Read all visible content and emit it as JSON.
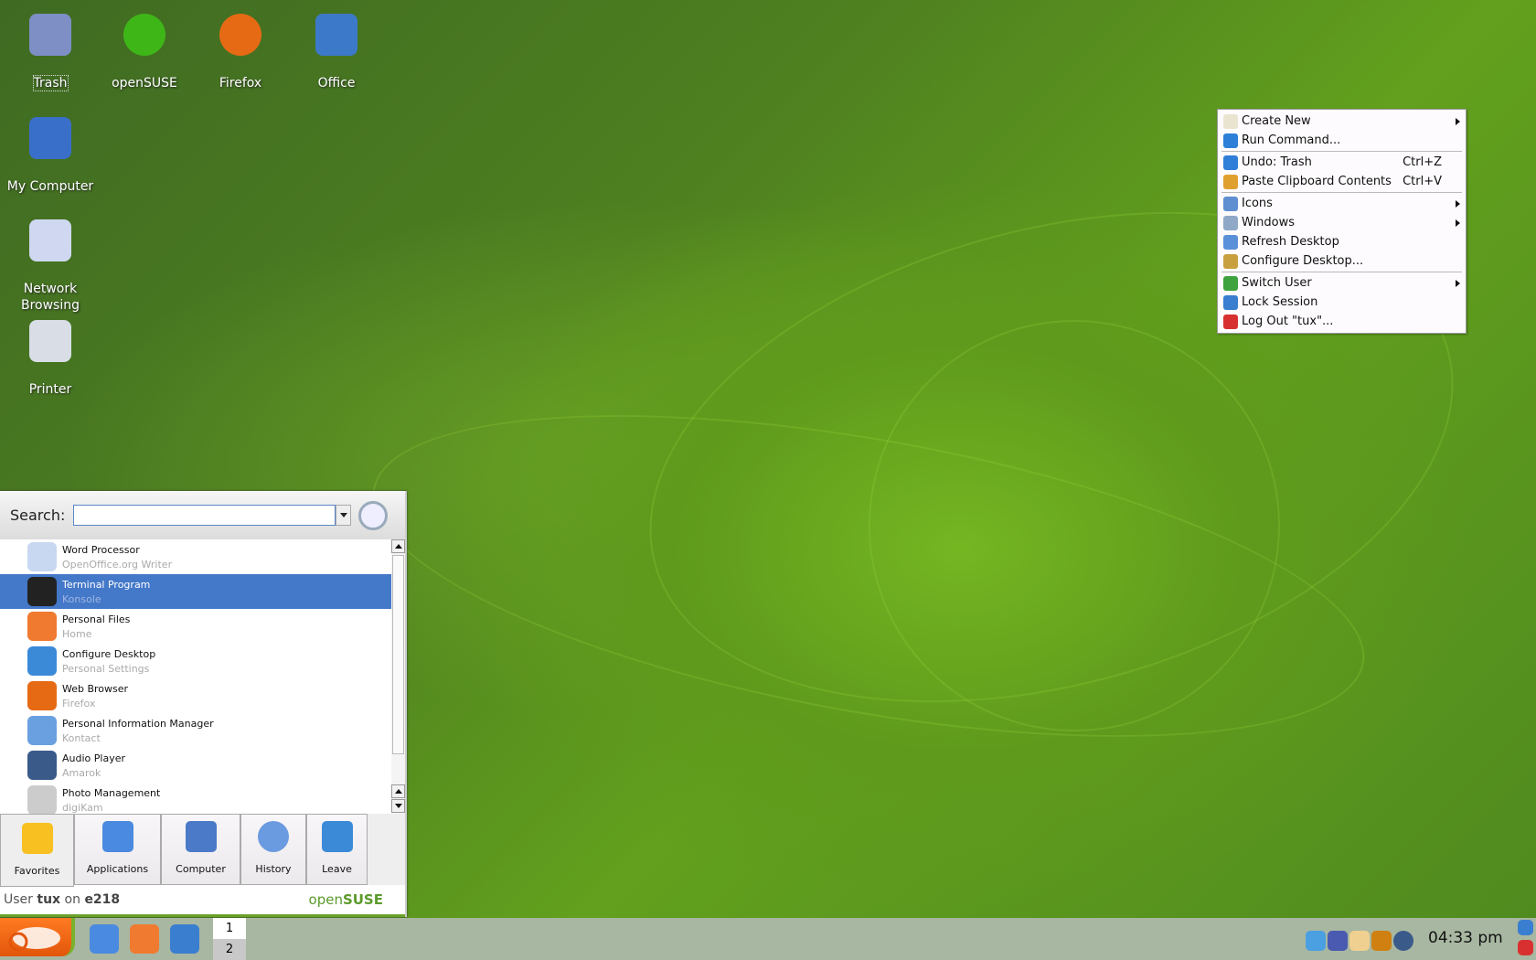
{
  "desktop_icons": [
    {
      "label": "Trash",
      "icon": "trash-icon",
      "color": "#7d8fc5"
    },
    {
      "label": "openSUSE",
      "icon": "opensuse-icon",
      "color": "#3fb618"
    },
    {
      "label": "Firefox",
      "icon": "firefox-icon",
      "color": "#e66a14"
    },
    {
      "label": "Office",
      "icon": "office-icon",
      "color": "#3d79c9"
    },
    {
      "label": "My Computer",
      "icon": "computer-icon",
      "color": "#3a6fc9"
    },
    {
      "label": "Network Browsing",
      "icon": "network-icon",
      "color": "#cfd8f0"
    },
    {
      "label": "Printer",
      "icon": "printer-icon",
      "color": "#d8dde6"
    }
  ],
  "context_menu": {
    "items": [
      {
        "label": "Create New",
        "icon": "new-file-icon",
        "color": "#e8e4d0",
        "submenu": true
      },
      {
        "label": "Run Command...",
        "icon": "run-icon",
        "color": "#2d7fd8"
      },
      {
        "label": "Undo: Trash",
        "shortcut": "Ctrl+Z",
        "icon": "undo-icon",
        "color": "#2f7fd8"
      },
      {
        "label": "Paste Clipboard Contents",
        "shortcut": "Ctrl+V",
        "icon": "paste-icon",
        "color": "#e0a030"
      },
      {
        "label": "Icons",
        "icon": "icons-icon",
        "color": "#5f8fd0",
        "submenu": true
      },
      {
        "label": "Windows",
        "icon": "windows-icon",
        "color": "#8fa8c8",
        "submenu": true
      },
      {
        "label": "Refresh Desktop",
        "icon": "refresh-icon",
        "color": "#5a90d8"
      },
      {
        "label": "Configure Desktop...",
        "icon": "wrench-icon",
        "color": "#c8a040"
      },
      {
        "label": "Switch User",
        "icon": "switch-user-icon",
        "color": "#3ea23e",
        "submenu": true
      },
      {
        "label": "Lock Session",
        "icon": "lock-icon",
        "color": "#3a7ed0"
      },
      {
        "label": "Log Out \"tux\"...",
        "icon": "logout-icon",
        "color": "#d83030"
      }
    ]
  },
  "launcher": {
    "search_label": "Search:",
    "search_value": "",
    "items": [
      {
        "title": "Word Processor",
        "subtitle": "OpenOffice.org Writer",
        "icon": "writer-icon",
        "color": "#c8d8f0"
      },
      {
        "title": "Terminal Program",
        "subtitle": "Konsole",
        "icon": "terminal-icon",
        "color": "#222"
      },
      {
        "title": "Personal Files",
        "subtitle": "Home",
        "icon": "home-icon",
        "color": "#f07a30"
      },
      {
        "title": "Configure Desktop",
        "subtitle": "Personal Settings",
        "icon": "configure-desktop-icon",
        "color": "#3a8ad8"
      },
      {
        "title": "Web Browser",
        "subtitle": "Firefox",
        "icon": "firefox-icon",
        "color": "#e66a14"
      },
      {
        "title": "Personal Information Manager",
        "subtitle": "Kontact",
        "icon": "kontact-icon",
        "color": "#6aa0e0"
      },
      {
        "title": "Audio Player",
        "subtitle": "Amarok",
        "icon": "amarok-icon",
        "color": "#3a5a8a"
      },
      {
        "title": "Photo Management",
        "subtitle": "digiKam",
        "icon": "digikam-icon",
        "color": "#ccc"
      }
    ],
    "selected_index": 1,
    "tabs": [
      {
        "label": "Favorites",
        "icon": "star-icon",
        "color": "#f8c020"
      },
      {
        "label": "Applications",
        "icon": "applications-icon",
        "color": "#4a8ae0"
      },
      {
        "label": "Computer",
        "icon": "computer-icon",
        "color": "#4a7ac8"
      },
      {
        "label": "History",
        "icon": "clock-icon",
        "color": "#6a9ae0"
      },
      {
        "label": "Leave",
        "icon": "leave-icon",
        "color": "#3a8ad8"
      }
    ],
    "footer_prefix": "User",
    "footer_user": "tux",
    "footer_on": "on",
    "footer_host": "e218",
    "brand_open": "open",
    "brand_suse": "SUSE"
  },
  "taskbar": {
    "quick_launch": [
      {
        "icon": "configure-icon",
        "color": "#4a8ae0"
      },
      {
        "icon": "home-icon",
        "color": "#f07a30"
      },
      {
        "icon": "konqueror-icon",
        "color": "#3a7ed0"
      }
    ],
    "pager": [
      "1",
      "2"
    ],
    "tray": [
      {
        "icon": "volume-icon",
        "color": "#4aa0e0"
      },
      {
        "icon": "network-icon",
        "color": "#4a5ab0"
      },
      {
        "icon": "klipper-icon",
        "color": "#f0d090"
      },
      {
        "icon": "wallet-icon",
        "color": "#d08010"
      },
      {
        "icon": "amarok-icon",
        "color": "#3a5a8a"
      }
    ],
    "clock": "04:33 pm"
  }
}
